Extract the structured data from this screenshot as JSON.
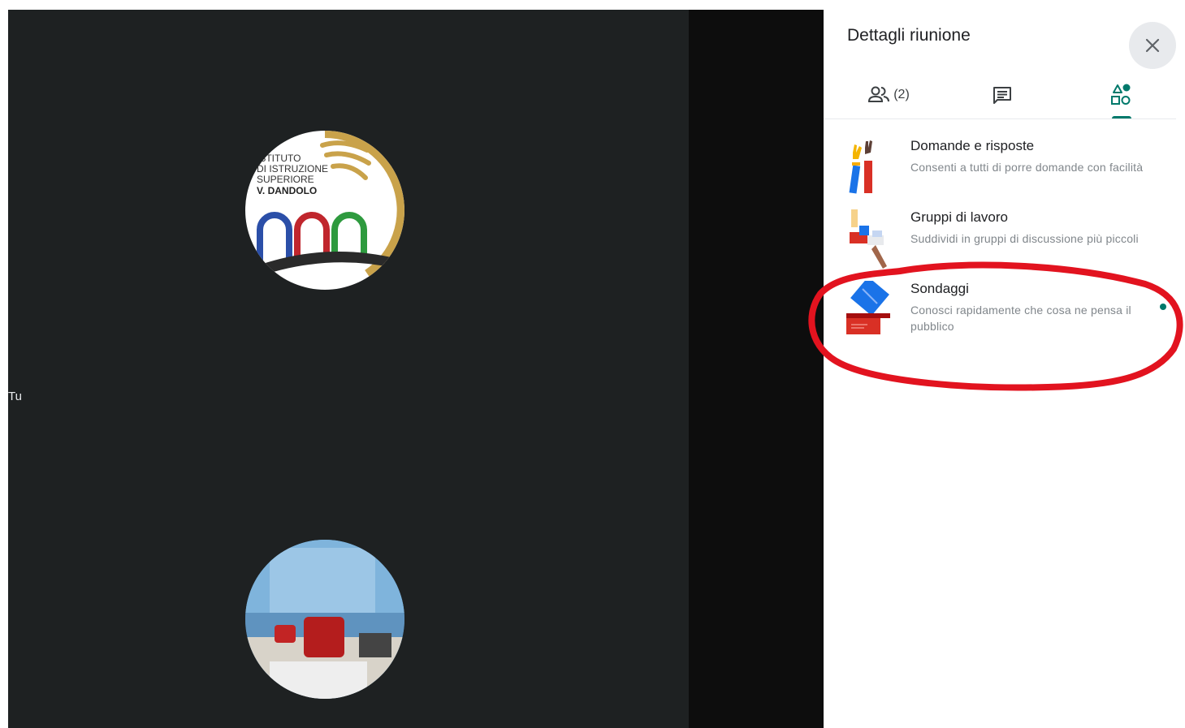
{
  "stage": {
    "self_label": "Tu",
    "logo_avatar": {
      "lines": [
        "ISTITUTO",
        "DI ISTRUZIONE",
        "SUPERIORE",
        "V. DANDOLO"
      ]
    }
  },
  "panel": {
    "title": "Dettagli riunione",
    "close_icon": "close-icon",
    "tabs": [
      {
        "icon": "people-icon",
        "count": "(2)"
      },
      {
        "icon": "chat-icon"
      },
      {
        "icon": "activities-icon",
        "active": true
      }
    ],
    "activities": [
      {
        "title": "Domande e risposte",
        "description": "Consenti a tutti di porre domande con facilità",
        "icon": "raised-hands-illustration"
      },
      {
        "title": "Gruppi di lavoro",
        "description": "Suddividi in gruppi di discussione più piccoli",
        "icon": "breakout-blocks-illustration"
      },
      {
        "title": "Sondaggi",
        "description": "Conosci rapidamente che cosa ne pensa il pubblico",
        "icon": "ballot-box-illustration",
        "new_badge": true
      }
    ]
  },
  "colors": {
    "accent": "#00796b",
    "annotation": "#e2131f",
    "stage": "#1e2122"
  }
}
